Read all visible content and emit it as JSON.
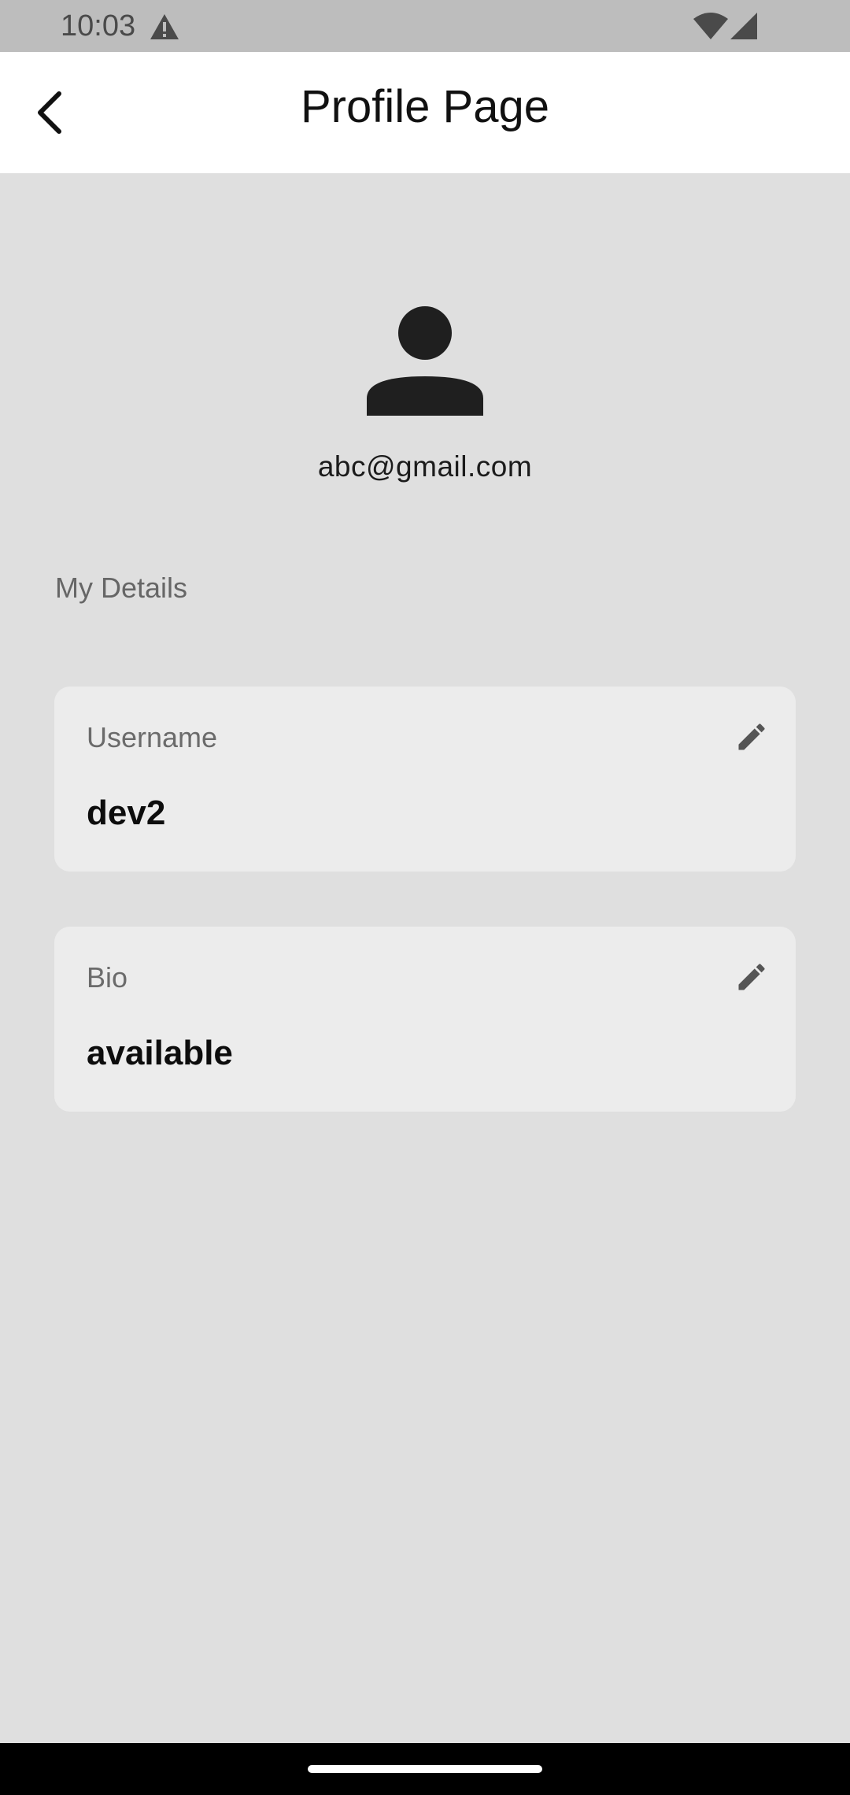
{
  "status_bar": {
    "time": "10:03",
    "icons": [
      "warning-icon",
      "wifi-icon",
      "signal-icon"
    ]
  },
  "app_bar": {
    "title": "Profile Page",
    "back_icon": "chevron-left-icon"
  },
  "profile": {
    "avatar_icon": "person-icon",
    "email": "abc@gmail.com"
  },
  "details": {
    "section_title": "My Details",
    "fields": [
      {
        "label": "Username",
        "value": "dev2",
        "edit_icon": "pencil-icon"
      },
      {
        "label": "Bio",
        "value": "available",
        "edit_icon": "pencil-icon"
      }
    ]
  },
  "colors": {
    "background": "#dfdfdf",
    "app_bar": "#ffffff",
    "status_bar": "#bdbdbd",
    "card": "#ececec",
    "icon": "#1f1f1f"
  }
}
